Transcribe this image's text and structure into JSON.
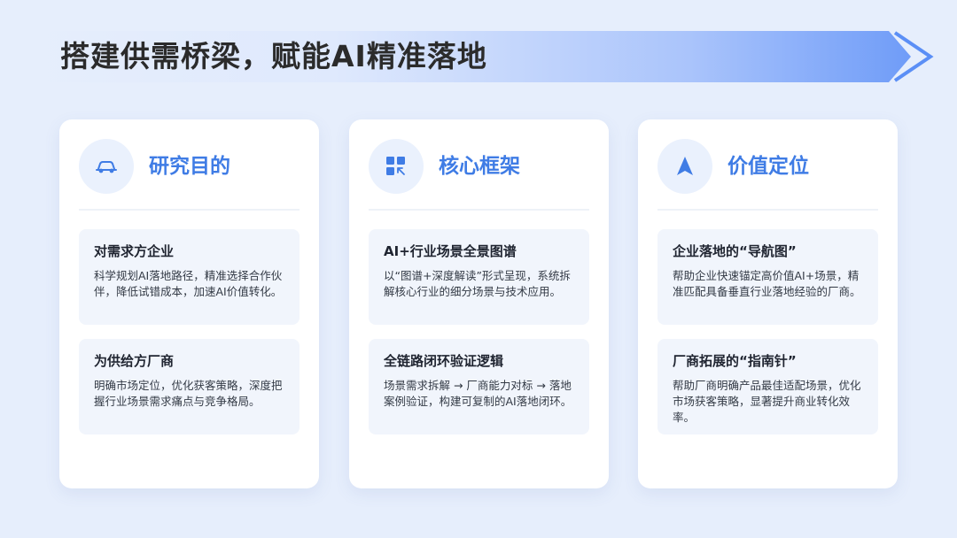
{
  "page": {
    "title": "搭建供需桥梁，赋能AI精准落地"
  },
  "cards": [
    {
      "icon": "car-icon",
      "title": "研究目的",
      "items": [
        {
          "title": "对需求方企业",
          "body": "科学规划AI落地路径，精准选择合作伙伴，降低试错成本，加速AI价值转化。"
        },
        {
          "title": "为供给方厂商",
          "body": "明确市场定位，优化获客策略，深度把握行业场景需求痛点与竞争格局。"
        }
      ]
    },
    {
      "icon": "grid-icon",
      "title": "核心框架",
      "items": [
        {
          "title": "AI+行业场景全景图谱",
          "body": "以“图谱+深度解读”形式呈现，系统拆解核心行业的细分场景与技术应用。"
        },
        {
          "title": "全链路闭环验证逻辑",
          "body": "场景需求拆解 → 厂商能力对标 → 落地案例验证，构建可复制的AI落地闭环。"
        }
      ]
    },
    {
      "icon": "navigation-arrow-icon",
      "title": "价值定位",
      "items": [
        {
          "title": "企业落地的“导航图”",
          "body": "帮助企业快速锚定高价值AI+场景，精准匹配具备垂直行业落地经验的厂商。"
        },
        {
          "title": "厂商拓展的“指南针”",
          "body": "帮助厂商明确产品最佳适配场景，优化市场获客策略，显著提升商业转化效率。"
        }
      ]
    }
  ],
  "colors": {
    "accent": "#3f7ce5",
    "background": "#e6eefc",
    "item_background": "#f1f5fc"
  }
}
